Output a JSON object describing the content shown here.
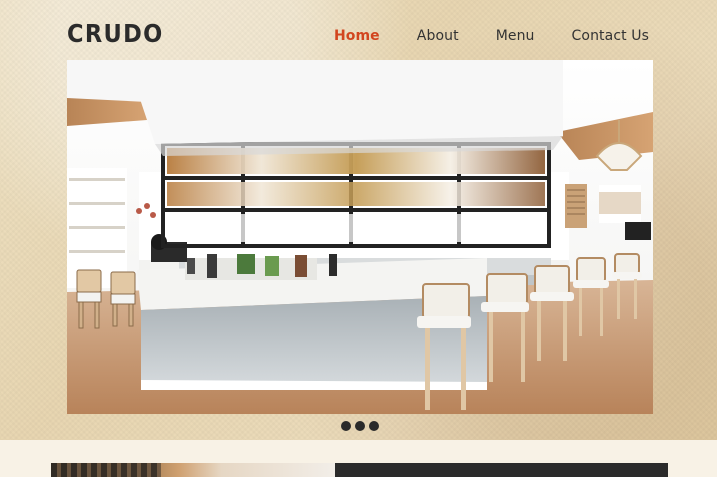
{
  "brand": {
    "name": "CRUDO"
  },
  "nav": {
    "items": [
      {
        "label": "Home",
        "active": true
      },
      {
        "label": "About",
        "active": false
      },
      {
        "label": "Menu",
        "active": false
      },
      {
        "label": "Contact Us",
        "active": false
      }
    ]
  },
  "hero": {
    "image_subject": "restaurant interior with bar counter and suspended shelving",
    "carousel": {
      "total_slides": 3
    }
  },
  "colors": {
    "accent": "#d2451e",
    "text": "#333333",
    "background": "#e8d6b1"
  }
}
